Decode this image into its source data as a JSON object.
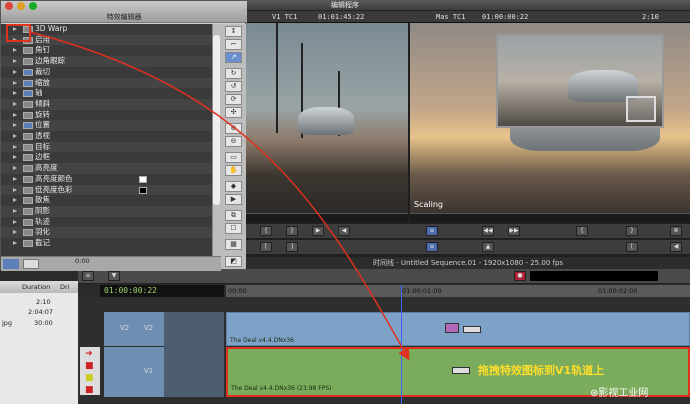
{
  "app_title": "编辑程序",
  "effect_palette": {
    "title": "特效编辑器",
    "effect_name": "3D Warp",
    "rows": [
      {
        "label": "3D Warp",
        "blue": false
      },
      {
        "label": "启用",
        "blue": false
      },
      {
        "label": "角钉",
        "blue": false
      },
      {
        "label": "边角跟踪",
        "blue": false
      },
      {
        "label": "裁切",
        "blue": true
      },
      {
        "label": "缩放",
        "blue": true
      },
      {
        "label": "轴",
        "blue": true
      },
      {
        "label": "倾斜",
        "blue": false
      },
      {
        "label": "旋转",
        "blue": false
      },
      {
        "label": "位置",
        "blue": true
      },
      {
        "label": "透视",
        "blue": false
      },
      {
        "label": "目标",
        "blue": false
      },
      {
        "label": "边框",
        "blue": false
      },
      {
        "label": "高亮度",
        "blue": false
      },
      {
        "label": "高亮度颜色",
        "blue": false,
        "swatch": "#ffffff"
      },
      {
        "label": "低亮度色彩",
        "blue": false,
        "swatch": "#000000"
      },
      {
        "label": "散焦",
        "blue": false
      },
      {
        "label": "阴影",
        "blue": false
      },
      {
        "label": "轨迹",
        "blue": false
      },
      {
        "label": "羽化",
        "blue": false
      },
      {
        "label": "截记",
        "blue": false
      }
    ],
    "bottom_time": "0:00"
  },
  "composer": {
    "left_track": "V1  TC1",
    "left_tc": "01:01:45:22",
    "right_track": "Mas  TC1",
    "right_tc": "01:00:00:22",
    "duration": "2:10",
    "overlay_label": "Scaling"
  },
  "sequence_title": "时间线 - Untitled Sequence.01 - 1920x1080 - 25.00 fps",
  "timeline": {
    "timecode": "01:00:00:22",
    "ruler": [
      "00:00",
      "01:00:01:00",
      "01:00:02:00"
    ],
    "tracks": [
      {
        "name": "V2",
        "clip": "The Deal v4.4.DNx36"
      },
      {
        "name": "V1",
        "clip": "The Deal v4.4.DNx36 (23.98 FPS)"
      }
    ]
  },
  "bin": {
    "columns": [
      "Duration",
      "Dri"
    ],
    "rows": [
      {
        "name": "",
        "duration": "2:10"
      },
      {
        "name": "",
        "duration": "2:04:07"
      },
      {
        "name": "jpg",
        "duration": "30:00"
      }
    ]
  },
  "annotation": "拖拽特效图标到V1轨道上",
  "watermark": "⊛影视工业网"
}
